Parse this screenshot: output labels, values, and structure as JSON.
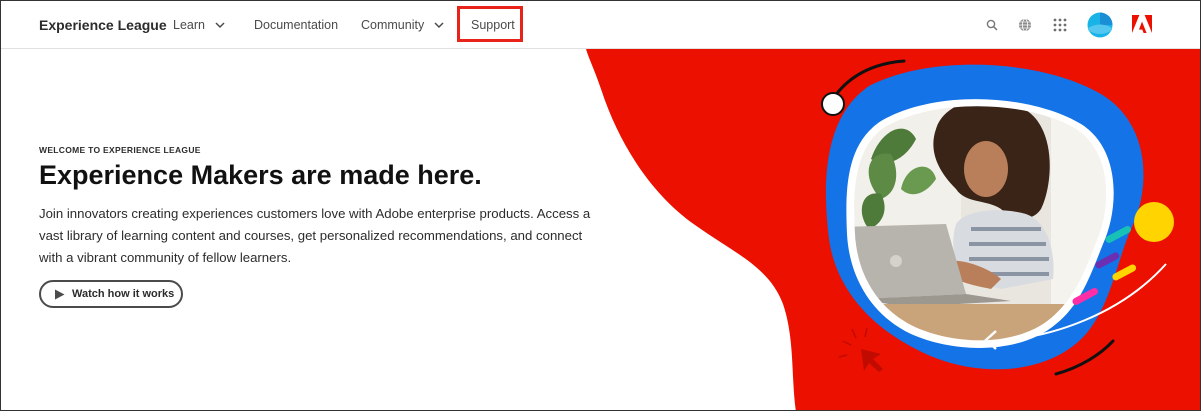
{
  "nav": {
    "brand": "Experience League",
    "items": [
      {
        "label": "Learn"
      },
      {
        "label": "Documentation"
      },
      {
        "label": "Community"
      },
      {
        "label": "Support"
      }
    ]
  },
  "icons": {
    "search": "search-icon",
    "language": "globe-icon",
    "apps": "app-grid-icon",
    "profile": "avatar",
    "adobe": "adobe-logo"
  },
  "hero": {
    "eyebrow": "WELCOME TO EXPERIENCE LEAGUE",
    "headline": "Experience Makers are made here.",
    "description": "Join innovators creating experiences customers love with Adobe enterprise products. Access a vast library of learning content and courses, get personalized recommendations, and connect with a vibrant community of fellow learners.",
    "cta": "Watch how it works"
  },
  "colors": {
    "accent_red": "#eb1000",
    "blue_blob": "#1473e6",
    "highlight_outline": "#e8231a",
    "avatar_cyan": "#18b4e8"
  }
}
